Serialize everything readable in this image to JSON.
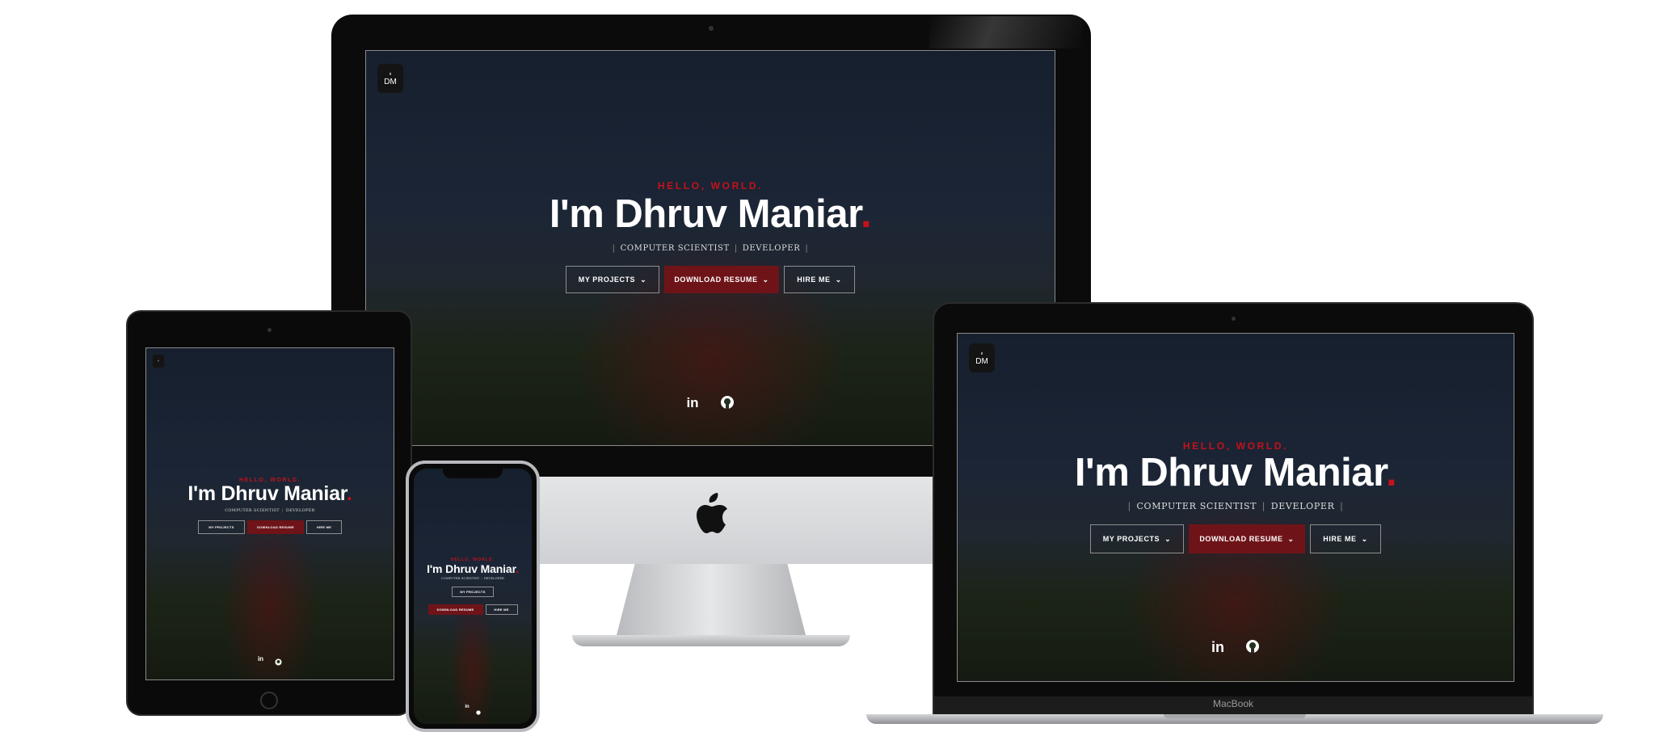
{
  "site": {
    "logo_text": "DM",
    "greeting": "HELLO, WORLD.",
    "name": "I'm Dhruv Maniar",
    "name_dot": ".",
    "roles": [
      "COMPUTER SCIENTIST",
      "DEVELOPER"
    ],
    "buttons": {
      "projects": "MY PROJECTS",
      "resume": "DOWNLOAD RESUME",
      "hire": "HIRE ME"
    },
    "social": [
      "linkedin-icon",
      "github-icon"
    ],
    "accent": "#c4121b",
    "resume_bg": "#6e1419"
  },
  "devices": {
    "laptop_label": "MacBook"
  }
}
